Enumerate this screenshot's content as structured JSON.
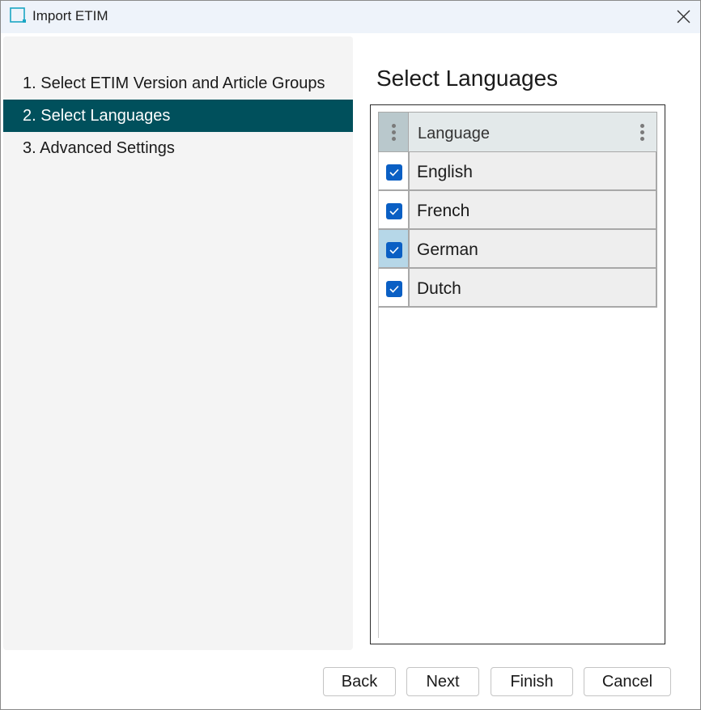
{
  "window": {
    "title": "Import ETIM",
    "icon": "app-window-icon",
    "close_icon": "close-icon"
  },
  "steps": {
    "items": [
      {
        "label": "1. Select ETIM Version and Article Groups",
        "active": false
      },
      {
        "label": "2. Select Languages",
        "active": true
      },
      {
        "label": "3. Advanced Settings",
        "active": false
      }
    ]
  },
  "main": {
    "heading": "Select Languages",
    "grid": {
      "column_header": "Language",
      "rows": [
        {
          "label": "English",
          "checked": true
        },
        {
          "label": "French",
          "checked": true
        },
        {
          "label": "German",
          "checked": true,
          "highlighted": true
        },
        {
          "label": "Dutch",
          "checked": true
        }
      ]
    }
  },
  "footer": {
    "back_label": "Back",
    "next_label": "Next",
    "finish_label": "Finish",
    "cancel_label": "Cancel"
  },
  "colors": {
    "accent_step": "#00505c",
    "checkbox": "#0a5fc4",
    "row_highlight": "#b6d7e8",
    "titlebar": "#eef3fa"
  }
}
